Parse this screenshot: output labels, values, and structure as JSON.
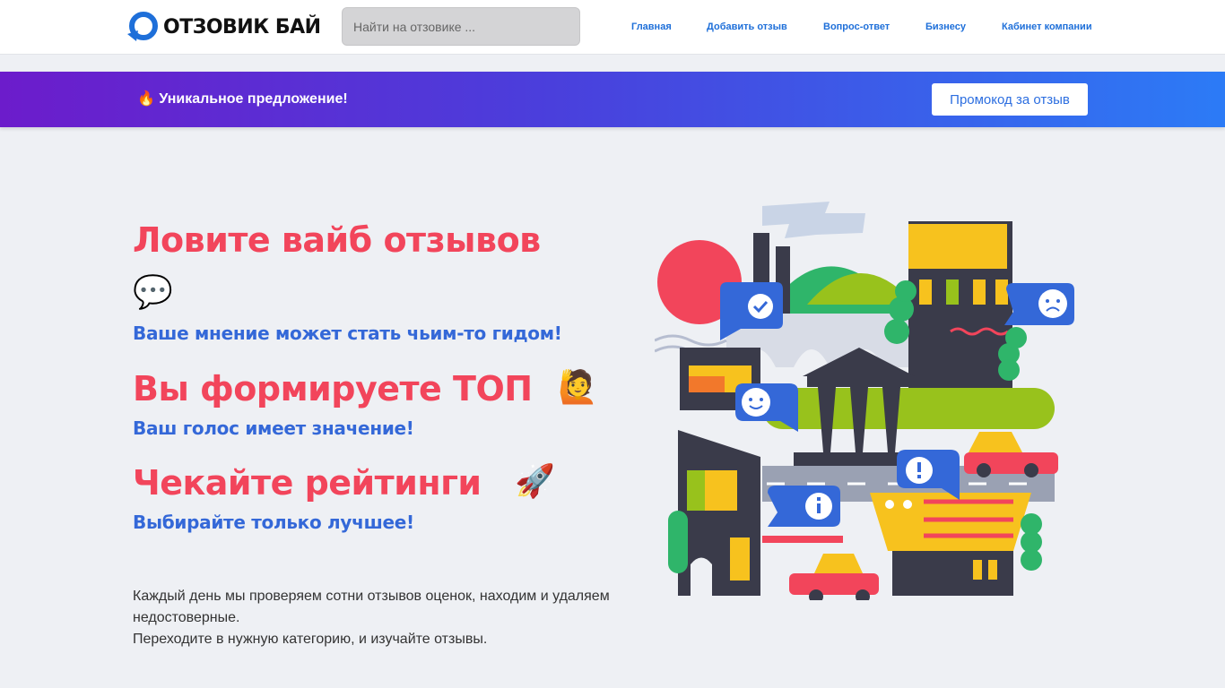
{
  "header": {
    "logo_text": "ОТЗОВИК БАЙ",
    "search_placeholder": "Найти на отзовике ...",
    "nav": [
      "Главная",
      "Добавить отзыв",
      "Вопрос-ответ",
      "Бизнесу",
      "Кабинет компании"
    ]
  },
  "promo": {
    "text": "🔥 Уникальное предложение!",
    "button": "Промокод за отзыв"
  },
  "hero": {
    "h1": "Ловите вайб отзывов",
    "h1_emoji": "💬",
    "sub1": "Ваше мнение может стать чьим-то гидом!",
    "h2": "Вы формируете ТОП",
    "h2_emoji": "🙋",
    "sub2": "Ваш голос имеет значение!",
    "h3": "Чекайте рейтинги",
    "h3_emoji": "🚀",
    "sub3": "Выбирайте только лучшее!",
    "para1": "Каждый день мы проверяем сотни отзывов оценок, находим и удаляем недостоверные.",
    "para2": "Переходите в нужную категорию, и изучайте отзывы."
  },
  "colors": {
    "accent_red": "#f2455b",
    "accent_blue": "#3468d8",
    "promo_gradient_start": "#6c1ccb",
    "promo_gradient_end": "#2c7bf6"
  }
}
